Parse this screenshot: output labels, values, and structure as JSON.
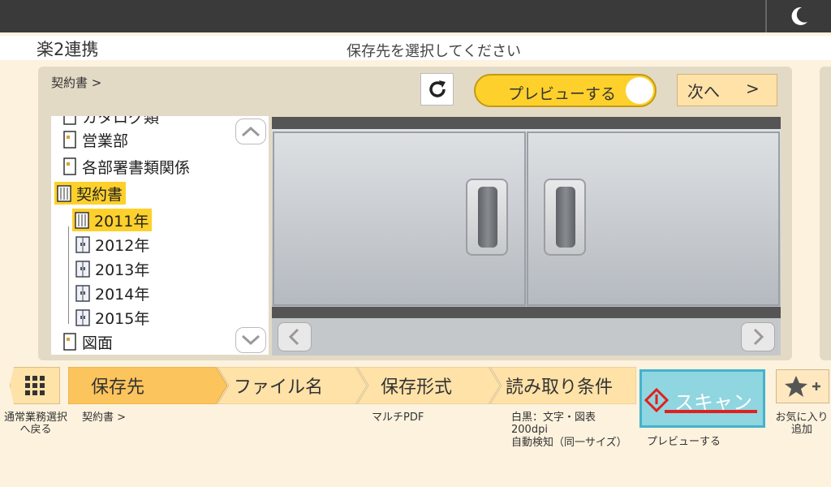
{
  "app": {
    "title": "楽2連携",
    "instruction": "保存先を選択してください"
  },
  "breadcrumb": "契約書 >",
  "toolbar": {
    "preview_label": "プレビューする",
    "next_label": "次へ",
    "next_arrow": ">"
  },
  "tree": {
    "items": [
      {
        "label": "カタログ類",
        "level": 0,
        "icon": "folder-icon"
      },
      {
        "label": "営業部",
        "level": 0,
        "icon": "folder-icon"
      },
      {
        "label": "各部署書類関係",
        "level": 0,
        "icon": "folder-icon"
      },
      {
        "label": "契約書",
        "level": 0,
        "icon": "cabinet-open-icon",
        "selected": true
      },
      {
        "label": "2011年",
        "level": 1,
        "icon": "cabinet-icon",
        "selected": true
      },
      {
        "label": "2012年",
        "level": 1,
        "icon": "cabinet-icon"
      },
      {
        "label": "2013年",
        "level": 1,
        "icon": "cabinet-icon"
      },
      {
        "label": "2014年",
        "level": 1,
        "icon": "cabinet-icon"
      },
      {
        "label": "2015年",
        "level": 1,
        "icon": "cabinet-icon"
      },
      {
        "label": "図面",
        "level": 0,
        "icon": "folder-icon"
      }
    ]
  },
  "tabs": {
    "home_caption": "通常業務選択\nへ戻る",
    "save_dest": {
      "label": "保存先",
      "sub": "契約書 >"
    },
    "file_name": {
      "label": "ファイル名",
      "sub": ""
    },
    "save_format": {
      "label": "保存形式",
      "sub": "マルチPDF"
    },
    "scan_settings": {
      "label": "読み取り条件",
      "sub_line1": "白黒：文字・図表",
      "sub_line2": "200dpi",
      "sub_line3": "自動検知（同一サイズ）"
    }
  },
  "scan": {
    "label": "スキャン",
    "sub": "プレビューする"
  },
  "favorite": {
    "caption_line1": "お気に入り",
    "caption_line2": "追加"
  },
  "colors": {
    "accent_yellow": "#fdd02c",
    "scan_blue": "#8fd6e0",
    "tab_active": "#fcc45c",
    "tab_inactive": "#ffe2a8"
  }
}
